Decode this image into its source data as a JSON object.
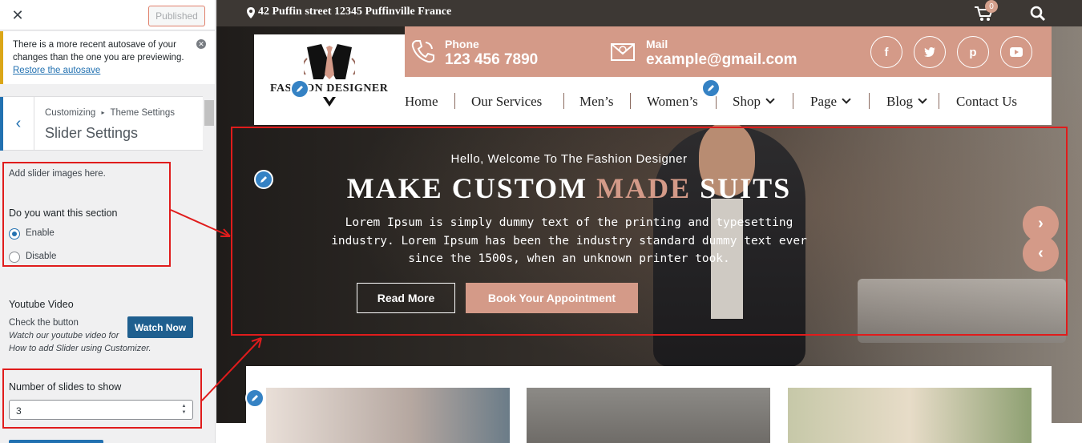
{
  "sidebar": {
    "close_icon": "close-icon",
    "publish_label": "Published",
    "notice": {
      "text": "There is a more recent autosave of your changes than the one you are previewing.",
      "link": "Restore the autosave"
    },
    "breadcrumb": {
      "root": "Customizing",
      "separator": "▸",
      "parent": "Theme Settings"
    },
    "section_title": "Slider Settings",
    "slider_help": "Add slider images here.",
    "section_question": "Do you want this section",
    "options": [
      {
        "label": "Enable",
        "selected": true
      },
      {
        "label": "Disable",
        "selected": false
      }
    ],
    "youtube": {
      "title": "Youtube Video",
      "check_text": "Check the button",
      "watch_label": "Watch Now",
      "italic_line1": "Watch our youtube video for",
      "italic_line2": "How to add Slider using Customizer."
    },
    "slides": {
      "label": "Number of slides to show",
      "value": "3"
    }
  },
  "preview": {
    "topbar": {
      "address": "42 Puffin street 12345 Puffinville France",
      "cart_count": "0"
    },
    "logo": "FASHION DESIGNER",
    "contact": {
      "phone_label": "Phone",
      "phone_value": "123 456 7890",
      "mail_label": "Mail",
      "mail_value": "example@gmail.com"
    },
    "social_icons": [
      "facebook-icon",
      "twitter-icon",
      "pinterest-icon",
      "youtube-icon"
    ],
    "nav": {
      "home": "Home",
      "services": "Our Services",
      "mens": "Men’s",
      "womens": "Women’s",
      "shop": "Shop",
      "page": "Page",
      "blog": "Blog",
      "contact": "Contact Us"
    },
    "hero": {
      "welcome": "Hello, Welcome To The Fashion Designer",
      "headline_part1": "MAKE CUSTOM ",
      "headline_accent": "MADE",
      "headline_part2": " SUITS",
      "description": "Lorem Ipsum is simply dummy text of the printing and typesetting industry. Lorem Ipsum has been the industry standard dummy text ever since the 1500s, when an unknown printer took.",
      "read_more": "Read More",
      "appointment": "Book Your Appointment"
    }
  },
  "colors": {
    "accent": "#d49a88",
    "topbar": "#3d3834",
    "wp_blue": "#2271b1",
    "annotation_red": "#e01c1c"
  }
}
